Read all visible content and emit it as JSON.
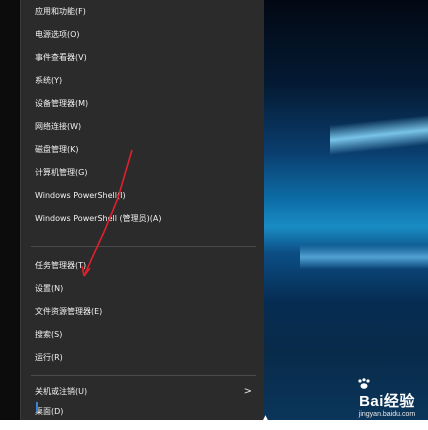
{
  "menu": {
    "items": [
      {
        "label": "应用和功能(F)"
      },
      {
        "label": "电源选项(O)"
      },
      {
        "label": "事件查看器(V)"
      },
      {
        "label": "系统(Y)"
      },
      {
        "label": "设备管理器(M)"
      },
      {
        "label": "网络连接(W)"
      },
      {
        "label": "磁盘管理(K)"
      },
      {
        "label": "计算机管理(G)"
      },
      {
        "label": "Windows PowerShell(I)"
      },
      {
        "label": "Windows PowerShell (管理员)(A)"
      },
      {
        "label": "任务管理器(T)"
      },
      {
        "label": "设置(N)"
      },
      {
        "label": "文件资源管理器(E)"
      },
      {
        "label": "搜索(S)"
      },
      {
        "label": "运行(R)"
      },
      {
        "label": "关机或注销(U)",
        "submenu_arrow": ">"
      },
      {
        "label": "桌面(D)"
      }
    ]
  },
  "watermark": {
    "logo": "Bai经验",
    "url": "jingyan.baidu.com"
  },
  "colors": {
    "menu_bg": "#2b2b2b",
    "text": "#f2f2f2",
    "annotation": "#e0202a"
  }
}
